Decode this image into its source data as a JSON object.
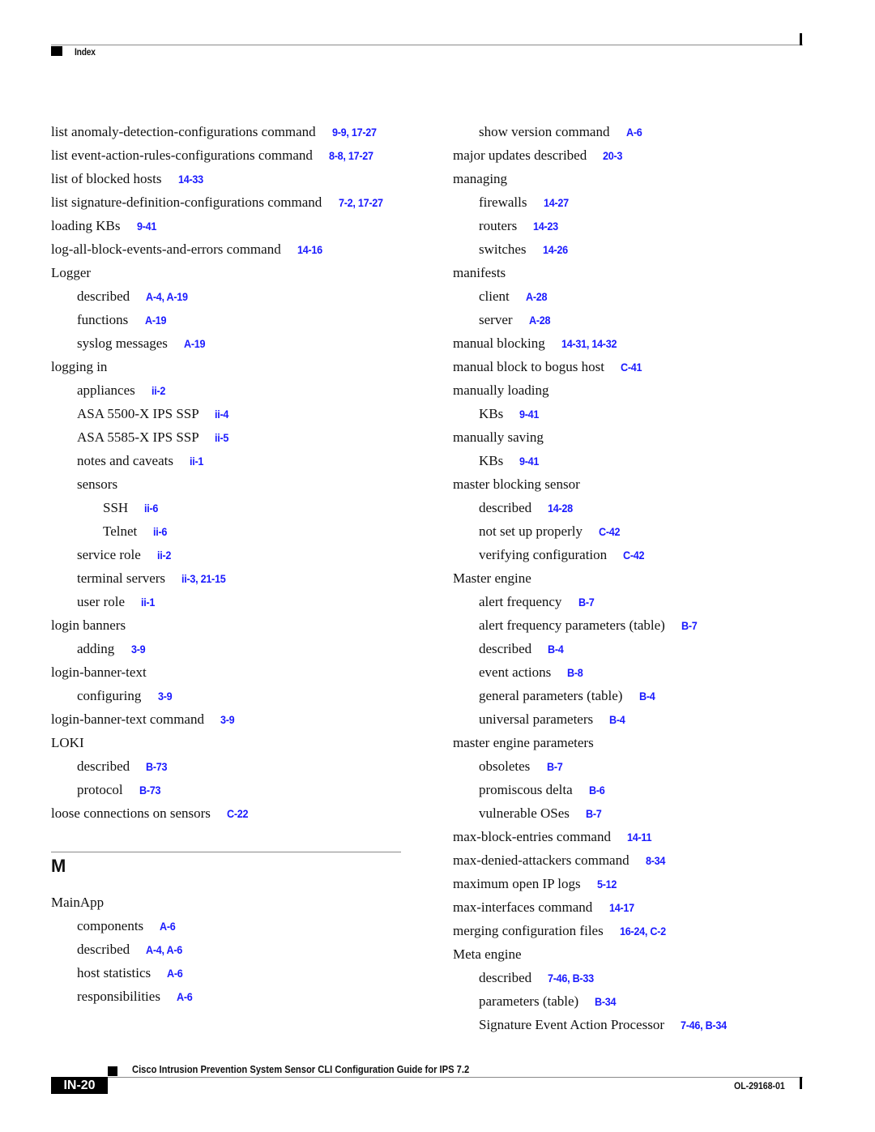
{
  "header": {
    "section_title": "Index"
  },
  "footer": {
    "guide_title": "Cisco Intrusion Prevention System Sensor CLI Configuration Guide for IPS 7.2",
    "page_number": "IN-20",
    "doc_number": "OL-29168-01"
  },
  "colors": {
    "link": "#1a1aff",
    "text": "#111111",
    "rule": "#8a8a8a"
  },
  "left_column": {
    "entries": [
      {
        "level": 0,
        "text": "list anomaly-detection-configurations command",
        "refs": "9-9, 17-27"
      },
      {
        "level": 0,
        "text": "list event-action-rules-configurations command",
        "refs": "8-8, 17-27"
      },
      {
        "level": 0,
        "text": "list of blocked hosts",
        "refs": "14-33"
      },
      {
        "level": 0,
        "text": "list signature-definition-configurations command",
        "refs": "7-2, 17-27",
        "wrap": true
      },
      {
        "level": 0,
        "text": "loading KBs",
        "refs": "9-41"
      },
      {
        "level": 0,
        "text": "log-all-block-events-and-errors command",
        "refs": "14-16"
      },
      {
        "level": 0,
        "text": "Logger",
        "refs": ""
      },
      {
        "level": 1,
        "text": "described",
        "refs": "A-4, A-19"
      },
      {
        "level": 1,
        "text": "functions",
        "refs": "A-19"
      },
      {
        "level": 1,
        "text": "syslog messages",
        "refs": "A-19"
      },
      {
        "level": 0,
        "text": "logging in",
        "refs": ""
      },
      {
        "level": 1,
        "text": "appliances",
        "refs": "ii-2"
      },
      {
        "level": 1,
        "text": "ASA 5500-X IPS SSP",
        "refs": "ii-4"
      },
      {
        "level": 1,
        "text": "ASA 5585-X IPS SSP",
        "refs": "ii-5"
      },
      {
        "level": 1,
        "text": "notes and caveats",
        "refs": "ii-1"
      },
      {
        "level": 1,
        "text": "sensors",
        "refs": ""
      },
      {
        "level": 2,
        "text": "SSH",
        "refs": "ii-6"
      },
      {
        "level": 2,
        "text": "Telnet",
        "refs": "ii-6"
      },
      {
        "level": 1,
        "text": "service role",
        "refs": "ii-2"
      },
      {
        "level": 1,
        "text": "terminal servers",
        "refs": "ii-3, 21-15"
      },
      {
        "level": 1,
        "text": "user role",
        "refs": "ii-1"
      },
      {
        "level": 0,
        "text": "login banners",
        "refs": ""
      },
      {
        "level": 1,
        "text": "adding",
        "refs": "3-9"
      },
      {
        "level": 0,
        "text": "login-banner-text",
        "refs": ""
      },
      {
        "level": 1,
        "text": "configuring",
        "refs": "3-9"
      },
      {
        "level": 0,
        "text": "login-banner-text command",
        "refs": "3-9"
      },
      {
        "level": 0,
        "text": "LOKI",
        "refs": ""
      },
      {
        "level": 1,
        "text": "described",
        "refs": "B-73"
      },
      {
        "level": 1,
        "text": "protocol",
        "refs": "B-73"
      },
      {
        "level": 0,
        "text": "loose connections on sensors",
        "refs": "C-22"
      }
    ],
    "section_letter": "M",
    "section_entries": [
      {
        "level": 0,
        "text": "MainApp",
        "refs": ""
      },
      {
        "level": 1,
        "text": "components",
        "refs": "A-6"
      },
      {
        "level": 1,
        "text": "described",
        "refs": "A-4, A-6"
      },
      {
        "level": 1,
        "text": "host statistics",
        "refs": "A-6"
      },
      {
        "level": 1,
        "text": "responsibilities",
        "refs": "A-6"
      }
    ]
  },
  "right_column": {
    "entries": [
      {
        "level": 1,
        "text": "show version command",
        "refs": "A-6"
      },
      {
        "level": 0,
        "text": "major updates described",
        "refs": "20-3"
      },
      {
        "level": 0,
        "text": "managing",
        "refs": ""
      },
      {
        "level": 1,
        "text": "firewalls",
        "refs": "14-27"
      },
      {
        "level": 1,
        "text": "routers",
        "refs": "14-23"
      },
      {
        "level": 1,
        "text": "switches",
        "refs": "14-26"
      },
      {
        "level": 0,
        "text": "manifests",
        "refs": ""
      },
      {
        "level": 1,
        "text": "client",
        "refs": "A-28"
      },
      {
        "level": 1,
        "text": "server",
        "refs": "A-28"
      },
      {
        "level": 0,
        "text": "manual blocking",
        "refs": "14-31, 14-32"
      },
      {
        "level": 0,
        "text": "manual block to bogus host",
        "refs": "C-41"
      },
      {
        "level": 0,
        "text": "manually loading",
        "refs": ""
      },
      {
        "level": 1,
        "text": "KBs",
        "refs": "9-41"
      },
      {
        "level": 0,
        "text": "manually saving",
        "refs": ""
      },
      {
        "level": 1,
        "text": "KBs",
        "refs": "9-41"
      },
      {
        "level": 0,
        "text": "master blocking sensor",
        "refs": ""
      },
      {
        "level": 1,
        "text": "described",
        "refs": "14-28"
      },
      {
        "level": 1,
        "text": "not set up properly",
        "refs": "C-42"
      },
      {
        "level": 1,
        "text": "verifying configuration",
        "refs": "C-42"
      },
      {
        "level": 0,
        "text": "Master engine",
        "refs": ""
      },
      {
        "level": 1,
        "text": "alert frequency",
        "refs": "B-7"
      },
      {
        "level": 1,
        "text": "alert frequency parameters (table)",
        "refs": "B-7"
      },
      {
        "level": 1,
        "text": "described",
        "refs": "B-4"
      },
      {
        "level": 1,
        "text": "event actions",
        "refs": "B-8"
      },
      {
        "level": 1,
        "text": "general parameters (table)",
        "refs": "B-4"
      },
      {
        "level": 1,
        "text": "universal parameters",
        "refs": "B-4"
      },
      {
        "level": 0,
        "text": "master engine parameters",
        "refs": ""
      },
      {
        "level": 1,
        "text": "obsoletes",
        "refs": "B-7"
      },
      {
        "level": 1,
        "text": "promiscous delta",
        "refs": "B-6"
      },
      {
        "level": 1,
        "text": "vulnerable OSes",
        "refs": "B-7"
      },
      {
        "level": 0,
        "text": "max-block-entries command",
        "refs": "14-11"
      },
      {
        "level": 0,
        "text": "max-denied-attackers command",
        "refs": "8-34"
      },
      {
        "level": 0,
        "text": "maximum open IP logs",
        "refs": "5-12"
      },
      {
        "level": 0,
        "text": "max-interfaces command",
        "refs": "14-17"
      },
      {
        "level": 0,
        "text": "merging configuration files",
        "refs": "16-24, C-2"
      },
      {
        "level": 0,
        "text": "Meta engine",
        "refs": ""
      },
      {
        "level": 1,
        "text": "described",
        "refs": "7-46, B-33"
      },
      {
        "level": 1,
        "text": "parameters (table)",
        "refs": "B-34"
      },
      {
        "level": 1,
        "text": "Signature Event Action Processor",
        "refs": "7-46, B-34"
      }
    ]
  }
}
